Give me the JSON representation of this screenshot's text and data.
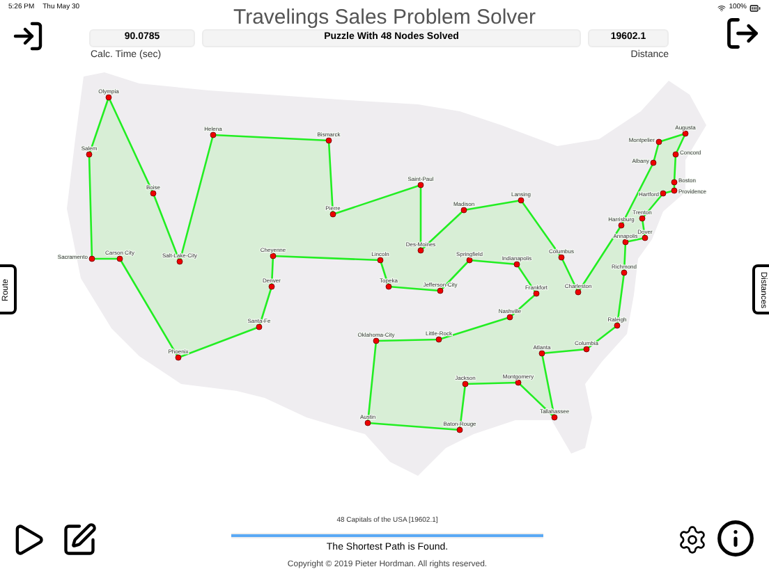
{
  "status_bar": {
    "time": "5:26 PM",
    "date": "Thu May 30",
    "battery": "100%"
  },
  "title": "Travelings Sales Problem Solver",
  "stats": {
    "calc_time": {
      "value": "90.0785",
      "label": "Calc. Time (sec)"
    },
    "message": "Puzzle With 48 Nodes Solved",
    "distance": {
      "value": "19602.1",
      "label": "Distance"
    }
  },
  "side_tabs": {
    "left": "Route",
    "right": "Distances"
  },
  "cities": [
    {
      "name": "Olympia"
    },
    {
      "name": "Augusta"
    },
    {
      "name": "Helena"
    },
    {
      "name": "Bismarck"
    },
    {
      "name": "Montpelier"
    },
    {
      "name": "Salem"
    },
    {
      "name": "Concord"
    },
    {
      "name": "Albany"
    },
    {
      "name": "Boston"
    },
    {
      "name": "Saint-Paul"
    },
    {
      "name": "Providence"
    },
    {
      "name": "Boise"
    },
    {
      "name": "Hartford"
    },
    {
      "name": "Lansing"
    },
    {
      "name": "Madison"
    },
    {
      "name": "Pierre"
    },
    {
      "name": "Trenton"
    },
    {
      "name": "Harrisburg"
    },
    {
      "name": "Dover"
    },
    {
      "name": "Annapolis"
    },
    {
      "name": "Sacramento"
    },
    {
      "name": "Carson City"
    },
    {
      "name": "Salt-Lake-City"
    },
    {
      "name": "Cheyenne"
    },
    {
      "name": "Lincoln"
    },
    {
      "name": "Des-Moines"
    },
    {
      "name": "Springfield"
    },
    {
      "name": "Indianapolis"
    },
    {
      "name": "Columbus"
    },
    {
      "name": "Richmond"
    },
    {
      "name": "Denver"
    },
    {
      "name": "Topeka"
    },
    {
      "name": "Jefferson-City"
    },
    {
      "name": "Frankfort"
    },
    {
      "name": "Charleston"
    },
    {
      "name": "Nashville"
    },
    {
      "name": "Raleigh"
    },
    {
      "name": "Santa-Fe"
    },
    {
      "name": "Little-Rock"
    },
    {
      "name": "Oklahoma-City"
    },
    {
      "name": "Columbia"
    },
    {
      "name": "Atlanta"
    },
    {
      "name": "Phoenix"
    },
    {
      "name": "Montgomery"
    },
    {
      "name": "Jackson"
    },
    {
      "name": "Tallahassee"
    },
    {
      "name": "Austin"
    },
    {
      "name": "Baton-Rouge"
    }
  ],
  "footer": {
    "caption": "48 Capitals of the USA [19602.1]",
    "progress": {
      "level": 1
    },
    "status": "The Shortest Path is Found.",
    "copyright": "Copyright © 2019 Pieter Hordman. All rights reserved."
  }
}
